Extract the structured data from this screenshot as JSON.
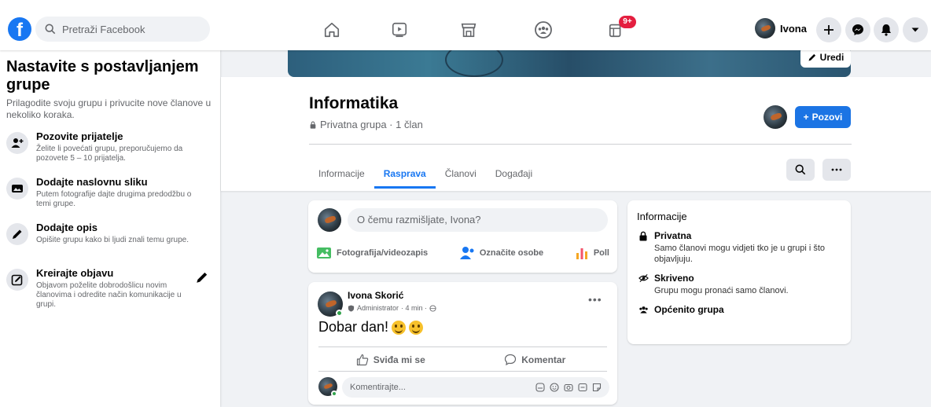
{
  "topbar": {
    "logo": "f",
    "search_placeholder": "Pretraži Facebook",
    "nav_icons": [
      "home-icon",
      "watch-icon",
      "marketplace-icon",
      "groups-icon",
      "gaming-icon"
    ],
    "badge": "9+",
    "profile_name": "Ivona",
    "round_buttons": [
      "plus-icon",
      "messenger-icon",
      "notifications-icon",
      "dropdown-icon"
    ]
  },
  "sidebar": {
    "title": "Nastavite s postavljanjem grupe",
    "intro": "Prilagodite svoju grupu i privucite nove članove u nekoliko koraka.",
    "steps": [
      {
        "icon": "add-friend-icon",
        "title": "Pozovite prijatelje",
        "desc": "Želite li povećati grupu, preporučujemo da pozovete 5 – 10 prijatelja."
      },
      {
        "icon": "photo-icon",
        "title": "Dodajte naslovnu sliku",
        "desc": "Putem fotografije dajte drugima predodžbu o temi grupe."
      },
      {
        "icon": "pencil-icon",
        "title": "Dodajte opis",
        "desc": "Opišite grupu kako bi ljudi znali temu grupe."
      },
      {
        "icon": "edit-post-icon",
        "title": "Kreirajte objavu",
        "desc": "Objavom poželite dobrodošlicu novim članovima i odredite način komunikacije u grupi."
      }
    ]
  },
  "group": {
    "edit_label": "Uredi",
    "name": "Informatika",
    "meta": "Privatna grupa · 1 član",
    "invite_label": "Pozovi",
    "tabs": [
      "Informacije",
      "Rasprava",
      "Članovi",
      "Događaji"
    ],
    "active_tab": "Rasprava"
  },
  "composer": {
    "placeholder": "O čemu razmišljate, Ivona?",
    "actions": [
      "Fotografija/videozapis",
      "Označite osobe",
      "Poll"
    ]
  },
  "post": {
    "author": "Ivona Skorić",
    "role": "Administrator",
    "time": "· 4 min ·",
    "text": "Dobar dan!",
    "like_label": "Sviđa mi se",
    "comment_label": "Komentar",
    "comment_placeholder": "Komentirajte..."
  },
  "info": {
    "heading": "Informacije",
    "items": [
      {
        "title": "Privatna",
        "desc": "Samo članovi mogu vidjeti tko je u grupi i što objavljuju."
      },
      {
        "title": "Skriveno",
        "desc": "Grupu mogu pronaći samo članovi."
      },
      {
        "title": "Općenito grupa",
        "desc": ""
      }
    ]
  },
  "colors": {
    "accent": "#1877f2",
    "badge": "#e41e3f",
    "background": "#f0f2f5"
  }
}
